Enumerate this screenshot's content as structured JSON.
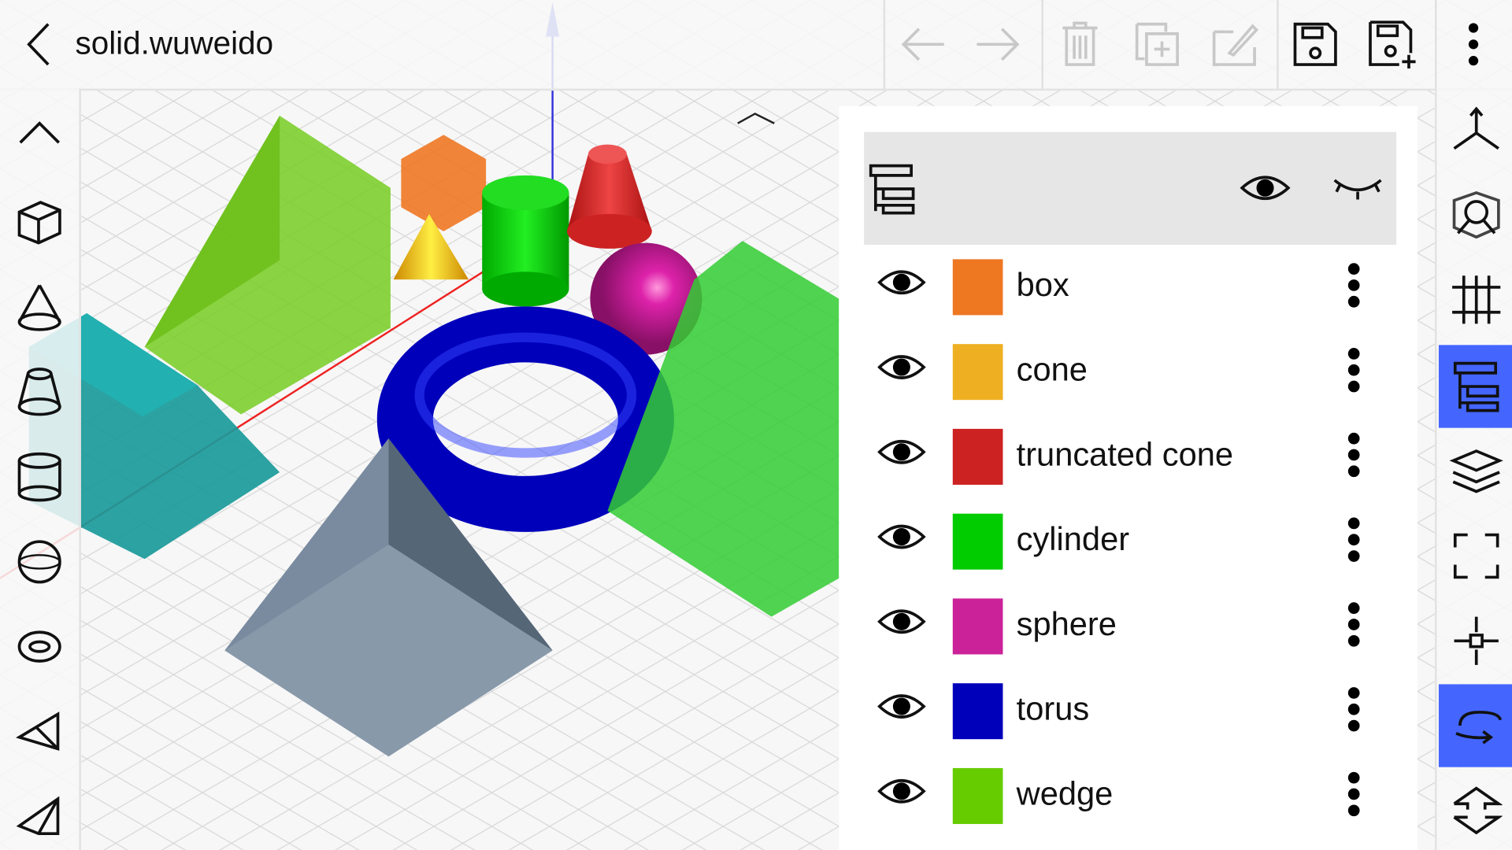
{
  "header": {
    "title": "solid.wuweido",
    "icons": [
      "back-icon",
      "undo-icon",
      "redo-icon",
      "delete-icon",
      "duplicate-icon",
      "edit-icon",
      "save-icon",
      "save-as-icon",
      "more-icon"
    ]
  },
  "left_toolbar": {
    "icons": [
      "collapse-up-icon",
      "box-icon",
      "cone-icon",
      "truncated-cone-icon",
      "cylinder-icon",
      "sphere-icon",
      "torus-icon",
      "wedge-icon",
      "pyramid-icon"
    ]
  },
  "right_toolbar": {
    "icons": [
      "axes-icon",
      "view-cube-icon",
      "grid-icon",
      "object-tree-icon",
      "layers-icon",
      "fit-view-icon",
      "move-icon",
      "rotate-icon",
      "flip-icon"
    ],
    "active": [
      "object-tree-icon",
      "rotate-icon"
    ]
  },
  "panel": {
    "header_icons": [
      "object-tree-icon",
      "show-all-icon",
      "hide-all-icon"
    ],
    "objects": [
      {
        "name": "box",
        "color": "#ee7722",
        "visible": true
      },
      {
        "name": "cone",
        "color": "#eeb022",
        "visible": true
      },
      {
        "name": "truncated cone",
        "color": "#cc2222",
        "visible": true
      },
      {
        "name": "cylinder",
        "color": "#00cc00",
        "visible": true
      },
      {
        "name": "sphere",
        "color": "#cc2299",
        "visible": true
      },
      {
        "name": "torus",
        "color": "#0000bb",
        "visible": true
      },
      {
        "name": "wedge",
        "color": "#66cc00",
        "visible": true
      }
    ]
  },
  "colors": {
    "accent": "#4466ff"
  }
}
